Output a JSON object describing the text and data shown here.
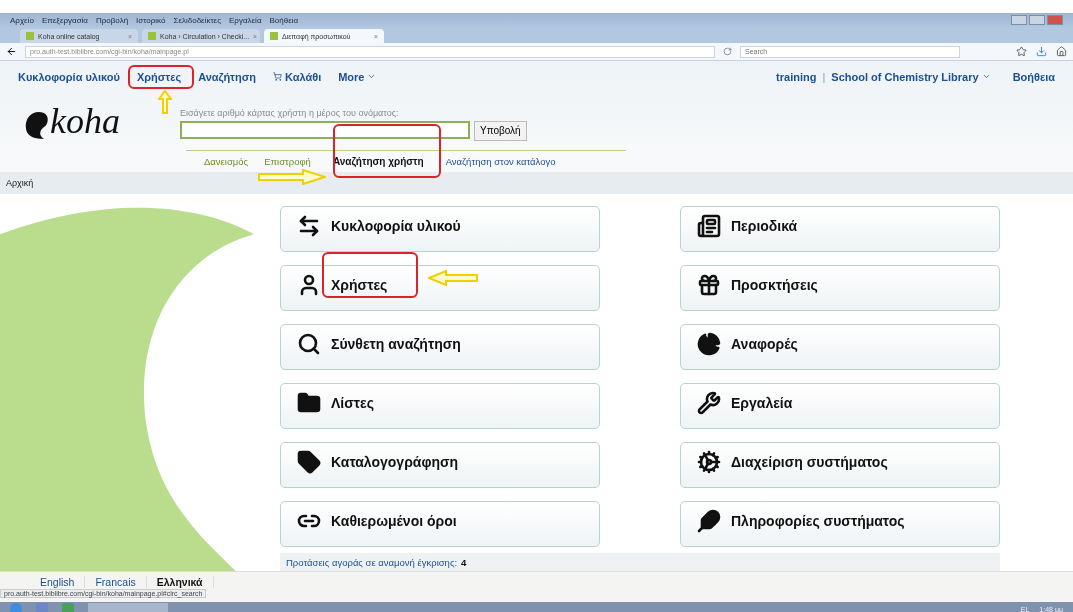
{
  "browser": {
    "menu": [
      "Αρχείο",
      "Επεξεργασία",
      "Προβολή",
      "Ιστορικό",
      "Σελιδοδείκτες",
      "Εργαλεία",
      "Βοήθεια"
    ],
    "tabs": [
      {
        "title": "Koha online catalog",
        "close": "×",
        "selected": false
      },
      {
        "title": "Koha › Circulation › Checki...",
        "close": "×",
        "selected": false
      },
      {
        "title": "Διεπαφή προσωπικού",
        "close": "×",
        "selected": true
      }
    ],
    "address": "pro.auth-test.biblibre.com/cgi-bin/koha/mainpage.pl",
    "search": {
      "placeholder": "Search"
    }
  },
  "nav": {
    "items": [
      {
        "label": "Κυκλοφορία υλικού",
        "kind": "link"
      },
      {
        "label": "Χρήστες",
        "kind": "link"
      },
      {
        "label": "Αναζήτηση",
        "kind": "link"
      },
      {
        "label": "Καλάθι",
        "kind": "cart"
      },
      {
        "label": "More",
        "kind": "menu"
      }
    ],
    "user": "training",
    "separator": "|",
    "library": "School of Chemistry Library",
    "help": "Βοήθεια"
  },
  "logo": "koha",
  "search": {
    "label": "Εισάγετε αριθμό κάρτας χρήστη η μέρος του ονόματος:",
    "button": "Υποβολή",
    "tabs": [
      {
        "label": "Δανεισμός",
        "selected": false
      },
      {
        "label": "Επιστροφή",
        "selected": false
      },
      {
        "label": "Αναζήτηση χρήστη",
        "selected": true
      },
      {
        "label": "Αναζήτηση στον κατάλογο",
        "selected": false
      }
    ]
  },
  "breadcrumb": "Αρχική",
  "modules": [
    {
      "label": "Κυκλοφορία υλικού",
      "kind": "circulation"
    },
    {
      "label": "Περιοδικά",
      "kind": "serials"
    },
    {
      "label": "Χρήστες",
      "kind": "patrons"
    },
    {
      "label": "Προσκτήσεις",
      "kind": "acquisitions"
    },
    {
      "label": "Σύνθετη αναζήτηση",
      "kind": "search"
    },
    {
      "label": "Αναφορές",
      "kind": "reports"
    },
    {
      "label": "Λίστες",
      "kind": "lists"
    },
    {
      "label": "Εργαλεία",
      "kind": "tools"
    },
    {
      "label": "Καταλογογράφηση",
      "kind": "cataloging"
    },
    {
      "label": "Διαχείριση συστήματος",
      "kind": "admin"
    },
    {
      "label": "Καθιερωμένοι όροι",
      "kind": "authorities"
    },
    {
      "label": "Πληροφορίες συστήματος",
      "kind": "about"
    }
  ],
  "pending": {
    "label": "Προτάσεις αγοράς σε αναμονή έγκρισης:",
    "count": "4"
  },
  "languages": [
    {
      "label": "English",
      "selected": false
    },
    {
      "label": "Francais",
      "selected": false
    },
    {
      "label": "Ελληνικά",
      "selected": true
    }
  ],
  "status_url": "pro.auth-test.biblibre.com/cgi-bin/koha/mainpage.pl#circ_search",
  "taskbar": {
    "language": "EL",
    "clock": "1:48 μμ"
  }
}
